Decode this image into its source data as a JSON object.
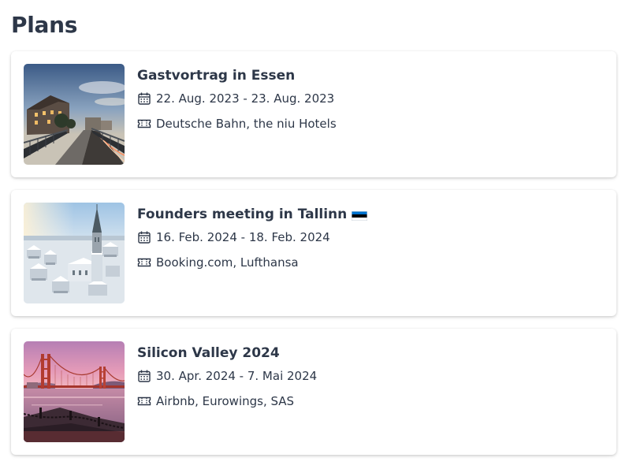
{
  "page": {
    "title": "Plans"
  },
  "plans": [
    {
      "name": "Gastvortrag in Essen",
      "dates": "22. Aug. 2023 - 23. Aug. 2023",
      "bookings": "Deutsche Bahn, the niu Hotels",
      "image": "bridge-with-building-photo"
    },
    {
      "name": "Founders meeting in Tallinn",
      "flag": "estonia-flag",
      "dates": "16. Feb. 2024 - 18. Feb. 2024",
      "bookings": "Booking.com, Lufthansa",
      "image": "snowy-old-town-church-spire-photo"
    },
    {
      "name": "Silicon Valley 2024",
      "dates": "30. Apr. 2024 - 7. Mai 2024",
      "bookings": "Airbnb, Eurowings, SAS",
      "image": "golden-gate-bridge-sunset-photo"
    }
  ],
  "icons": {
    "dates": "calendar-icon",
    "bookings": "ticket-icon"
  },
  "colors": {
    "text": "#2d3748",
    "card_bg": "#ffffff",
    "estonia_blue": "#0072ce",
    "estonia_black": "#000000",
    "estonia_white": "#ffffff"
  }
}
